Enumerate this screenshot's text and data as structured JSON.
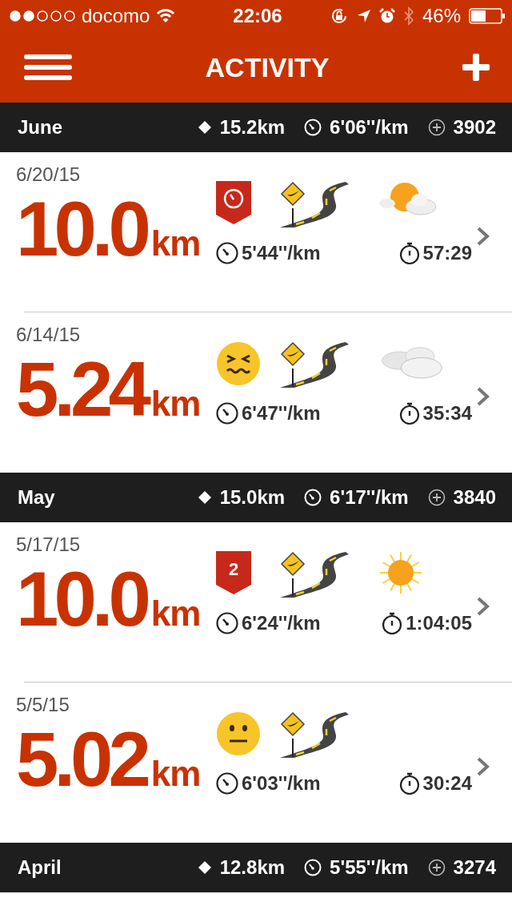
{
  "status_bar": {
    "carrier": "docomo",
    "time": "22:06",
    "battery": "46%"
  },
  "nav": {
    "title": "ACTIVITY"
  },
  "months": [
    {
      "name": "June",
      "distance": "15.2km",
      "pace": "6'06''/km",
      "fuel": "3902",
      "runs": [
        {
          "date": "6/20/15",
          "distance": "10.0",
          "unit": "km",
          "icons": [
            {
              "kind": "speed_badge"
            },
            {
              "kind": "road"
            },
            {
              "kind": "partly_cloudy"
            }
          ],
          "pace": "5'44''/km",
          "duration": "57:29"
        },
        {
          "date": "6/14/15",
          "distance": "5.24",
          "unit": "km",
          "icons": [
            {
              "kind": "strained_face"
            },
            {
              "kind": "road"
            },
            {
              "kind": "cloudy"
            }
          ],
          "pace": "6'47''/km",
          "duration": "35:34"
        }
      ]
    },
    {
      "name": "May",
      "distance": "15.0km",
      "pace": "6'17''/km",
      "fuel": "3840",
      "runs": [
        {
          "date": "5/17/15",
          "distance": "10.0",
          "unit": "km",
          "icons": [
            {
              "kind": "number_badge",
              "text": "2"
            },
            {
              "kind": "road"
            },
            {
              "kind": "sunny"
            }
          ],
          "pace": "6'24''/km",
          "duration": "1:04:05"
        },
        {
          "date": "5/5/15",
          "distance": "5.02",
          "unit": "km",
          "icons": [
            {
              "kind": "neutral_face"
            },
            {
              "kind": "road"
            }
          ],
          "pace": "6'03''/km",
          "duration": "30:24"
        }
      ]
    },
    {
      "name": "April",
      "distance": "12.8km",
      "pace": "5'55''/km",
      "fuel": "3274"
    }
  ]
}
